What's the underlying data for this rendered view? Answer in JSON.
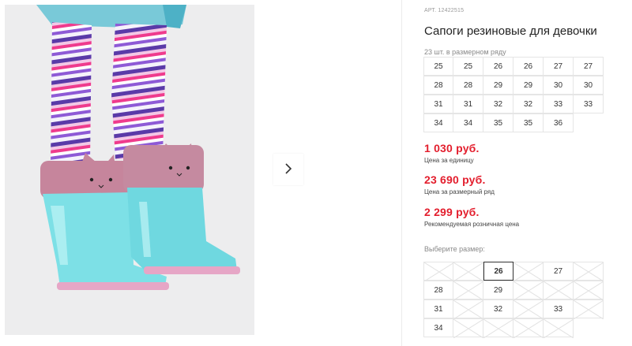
{
  "product": {
    "article": "АРТ. 12422515",
    "title": "Сапоги резиновые для девочки",
    "pack_note": "23 шт. в размерном ряду"
  },
  "size_grid": [
    [
      "25",
      "25",
      "26",
      "26",
      "27",
      "27"
    ],
    [
      "28",
      "28",
      "29",
      "29",
      "30",
      "30"
    ],
    [
      "31",
      "31",
      "32",
      "32",
      "33",
      "33"
    ],
    [
      "34",
      "34",
      "35",
      "35",
      "36"
    ]
  ],
  "prices": {
    "unit_price": "1 030 руб.",
    "unit_caption": "Цена за единицу",
    "pack_price": "23 690 руб.",
    "pack_caption": "Цена за размерный ряд",
    "retail_price": "2 299 руб.",
    "retail_caption": "Рекомендуемая розничная цена",
    "price_color": "#e31e2d"
  },
  "size_picker": {
    "label": "Выберите размер:",
    "selected": "26",
    "rows": [
      [
        {
          "v": "",
          "a": false
        },
        {
          "v": "",
          "a": false
        },
        {
          "v": "26",
          "a": true,
          "sel": true
        },
        {
          "v": "",
          "a": false
        },
        {
          "v": "27",
          "a": true
        },
        {
          "v": "",
          "a": false
        }
      ],
      [
        {
          "v": "28",
          "a": true
        },
        {
          "v": "",
          "a": false
        },
        {
          "v": "29",
          "a": true
        },
        {
          "v": "",
          "a": false
        },
        {
          "v": "",
          "a": false
        },
        {
          "v": "",
          "a": false
        }
      ],
      [
        {
          "v": "31",
          "a": true
        },
        {
          "v": "",
          "a": false
        },
        {
          "v": "32",
          "a": true
        },
        {
          "v": "",
          "a": false
        },
        {
          "v": "33",
          "a": true
        },
        {
          "v": "",
          "a": false
        }
      ],
      [
        {
          "v": "34",
          "a": true
        },
        {
          "v": "",
          "a": false
        },
        {
          "v": "",
          "a": false
        },
        {
          "v": "",
          "a": false
        },
        {
          "v": "",
          "a": false
        }
      ]
    ]
  },
  "icons": {
    "next": "chevron-right-icon",
    "unavailable": "cross-out-icon"
  }
}
